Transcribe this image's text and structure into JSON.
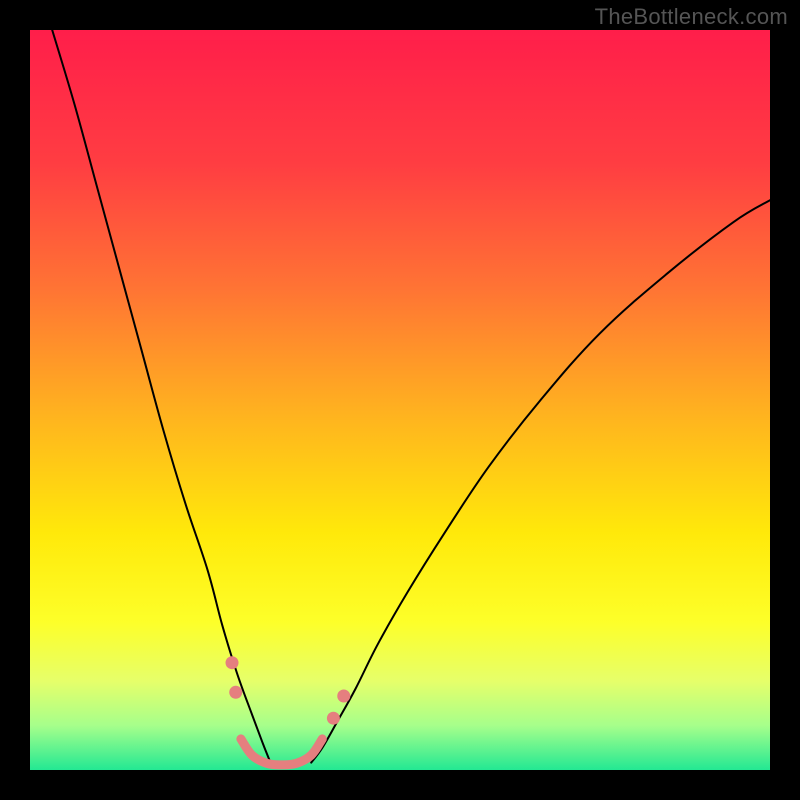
{
  "watermark": "TheBottleneck.com",
  "chart_data": {
    "type": "line",
    "title": "",
    "xlabel": "",
    "ylabel": "",
    "xlim": [
      0,
      100
    ],
    "ylim": [
      0,
      100
    ],
    "grid": false,
    "legend": false,
    "background_gradient": {
      "stops": [
        {
          "offset": 0.0,
          "color": "#ff1e4a"
        },
        {
          "offset": 0.18,
          "color": "#ff3d42"
        },
        {
          "offset": 0.35,
          "color": "#ff7434"
        },
        {
          "offset": 0.52,
          "color": "#ffb31f"
        },
        {
          "offset": 0.68,
          "color": "#ffe90a"
        },
        {
          "offset": 0.8,
          "color": "#fdff29"
        },
        {
          "offset": 0.88,
          "color": "#e6ff6a"
        },
        {
          "offset": 0.94,
          "color": "#a6ff8b"
        },
        {
          "offset": 1.0,
          "color": "#23e893"
        }
      ]
    },
    "series": [
      {
        "name": "left-curve",
        "x": [
          3,
          6,
          9,
          12,
          15,
          18,
          21,
          24,
          26,
          28,
          30,
          31.5,
          32.5
        ],
        "y": [
          100,
          90,
          79,
          68,
          57,
          46,
          36,
          27,
          19.5,
          13,
          7.5,
          3.5,
          1
        ],
        "stroke": "#000000",
        "width": 2
      },
      {
        "name": "right-curve",
        "x": [
          38,
          39.5,
          41.5,
          44,
          47,
          51,
          56,
          62,
          69,
          77,
          86,
          95,
          100
        ],
        "y": [
          1,
          3,
          6.5,
          11,
          17,
          24,
          32,
          41,
          50,
          59,
          67,
          74,
          77
        ],
        "stroke": "#000000",
        "width": 2
      },
      {
        "name": "valley-floor",
        "x": [
          28.5,
          30,
          32,
          34,
          36,
          38,
          39.5
        ],
        "y": [
          4.2,
          2.0,
          0.9,
          0.7,
          0.9,
          2.0,
          4.2
        ],
        "stroke": "#e57f7f",
        "width": 9
      }
    ],
    "markers": [
      {
        "name": "left-upper-dot",
        "x": 27.3,
        "y": 14.5,
        "r": 6.5,
        "color": "#e57f7f"
      },
      {
        "name": "left-lower-dot",
        "x": 27.8,
        "y": 10.5,
        "r": 6.5,
        "color": "#e57f7f"
      },
      {
        "name": "right-lower-dot",
        "x": 41.0,
        "y": 7.0,
        "r": 6.5,
        "color": "#e57f7f"
      },
      {
        "name": "right-upper-dot",
        "x": 42.4,
        "y": 10.0,
        "r": 6.5,
        "color": "#e57f7f"
      }
    ]
  }
}
